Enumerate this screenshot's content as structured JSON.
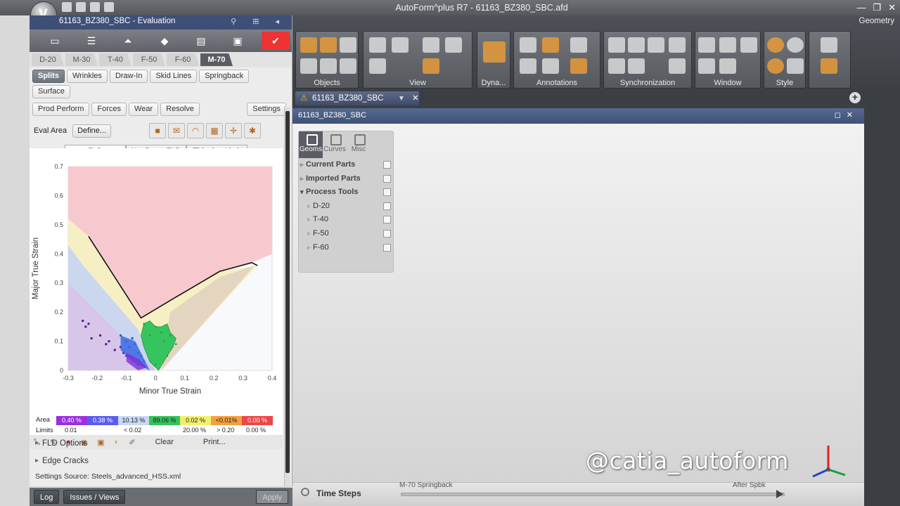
{
  "window": {
    "title": "AutoForm^plus R7 - 61163_BZ380_SBC.afd",
    "controls": [
      "—",
      "❐",
      "✕"
    ]
  },
  "panel": {
    "title": "61163_BZ380_SBC - Evaluation",
    "steps": [
      "D-20",
      "M-30",
      "T-40",
      "F-50",
      "F-60",
      "M-70"
    ],
    "active_step": "M-70",
    "modes": [
      "Splits",
      "Wrinkles",
      "Draw-In",
      "Skid Lines",
      "Springback",
      "Surface",
      "Prod Perform",
      "Forces",
      "Wear",
      "Resolve"
    ],
    "active_mode": "Splits",
    "settings_label": "Settings",
    "eval_area_label": "Eval Area",
    "define_label": "Define...",
    "fld_tabs": [
      "FLD",
      "Nonlinear FLD",
      "Thinning Limit"
    ]
  },
  "chart_data": {
    "type": "scatter",
    "xlabel": "Minor True Strain",
    "ylabel": "Major True Strain",
    "xlim": [
      -0.3,
      0.4
    ],
    "ylim": [
      0,
      0.7
    ],
    "xticks": [
      "-0.3",
      "-0.2",
      "-0.1",
      "0",
      "0.1",
      "0.2",
      "0.3",
      "0.4"
    ],
    "yticks": [
      "0",
      "0.1",
      "0.2",
      "0.3",
      "0.4",
      "0.5",
      "0.6",
      "0.7"
    ],
    "flc_curve": [
      [
        -0.23,
        0.46
      ],
      [
        -0.05,
        0.18
      ],
      [
        0.05,
        0.24
      ],
      [
        0.22,
        0.34
      ],
      [
        0.33,
        0.37
      ],
      [
        0.35,
        0.36
      ]
    ],
    "zones": [
      {
        "name": "split",
        "color": "#f7c9cf"
      },
      {
        "name": "risk",
        "color": "#f6efc4"
      },
      {
        "name": "safe",
        "color": "#e3d5bf"
      },
      {
        "name": "compress",
        "color": "#cbd7ee"
      },
      {
        "name": "thickening",
        "color": "#d8c6ea"
      }
    ],
    "points_purple": [
      [
        -0.25,
        0.17
      ],
      [
        -0.24,
        0.15
      ],
      [
        -0.23,
        0.16
      ],
      [
        -0.22,
        0.11
      ],
      [
        -0.19,
        0.12
      ],
      [
        -0.17,
        0.09
      ],
      [
        -0.16,
        0.1
      ],
      [
        -0.14,
        0.07
      ],
      [
        -0.12,
        0.08
      ],
      [
        -0.11,
        0.06
      ],
      [
        -0.1,
        0.05
      ]
    ],
    "points_blue": [
      [
        -0.12,
        0.12
      ],
      [
        -0.1,
        0.1
      ],
      [
        -0.09,
        0.08
      ],
      [
        -0.08,
        0.11
      ],
      [
        -0.07,
        0.09
      ],
      [
        -0.06,
        0.06
      ],
      [
        -0.05,
        0.05
      ],
      [
        -0.04,
        0.03
      ],
      [
        -0.06,
        0.02
      ]
    ],
    "points_green": [
      [
        -0.04,
        0.16
      ],
      [
        -0.02,
        0.12
      ],
      [
        0.0,
        0.15
      ],
      [
        0.02,
        0.13
      ],
      [
        0.03,
        0.1
      ],
      [
        0.05,
        0.12
      ],
      [
        0.07,
        0.09
      ],
      [
        0.04,
        0.05
      ],
      [
        0.0,
        0.02
      ]
    ]
  },
  "legend": {
    "area_label": "Area",
    "limits_label": "Limits",
    "cells": [
      {
        "value": "0.40 %",
        "color": "#9b2fe0"
      },
      {
        "value": "0.38 %",
        "color": "#5b5bf0"
      },
      {
        "value": "10.13 %",
        "color": "#c9d8f3"
      },
      {
        "value": "89.06 %",
        "color": "#34c35b"
      },
      {
        "value": "0.02 %",
        "color": "#f1f06b"
      },
      {
        "value": "<0.01%",
        "color": "#f5a13f"
      },
      {
        "value": "0.00 %",
        "color": "#f04545"
      }
    ],
    "limits": [
      "0.01",
      "< 0.02",
      "20.00 %",
      "> 0.20",
      "0.00 %"
    ]
  },
  "bottom_tools": {
    "clear": "Clear",
    "print": "Print..."
  },
  "accordions": [
    "FLD Options",
    "Edge Cracks"
  ],
  "settings_source": "Settings Source:   Steels_advanced_HSS.xml",
  "statusbar": {
    "log": "Log",
    "issues": "Issues / Views",
    "apply": "Apply"
  },
  "ribbon": {
    "geometry_tab": "Geometry",
    "groups": [
      "Objects",
      "View",
      "Dyna...",
      "Annotations",
      "Synchronization",
      "Window",
      "Style"
    ]
  },
  "document_tab": "61163_BZ380_SBC",
  "viewport_title": "61163_BZ380_SBC",
  "tree": {
    "tabs": [
      "Geoms",
      "Curves",
      "Misc"
    ],
    "nodes": [
      {
        "label": "Current Parts",
        "child": false,
        "open": false
      },
      {
        "label": "Imported Parts",
        "child": false,
        "open": false
      },
      {
        "label": "Process Tools",
        "child": false,
        "open": true
      },
      {
        "label": "D-20",
        "child": true,
        "open": false
      },
      {
        "label": "T-40",
        "child": true,
        "open": false
      },
      {
        "label": "F-50",
        "child": true,
        "open": false
      },
      {
        "label": "F-60",
        "child": true,
        "open": false
      }
    ]
  },
  "timebar": {
    "label": "Time Steps",
    "left_marker": "M-70 Springback",
    "right_marker": "After Spbk"
  },
  "watermark": "@catia_autoform"
}
